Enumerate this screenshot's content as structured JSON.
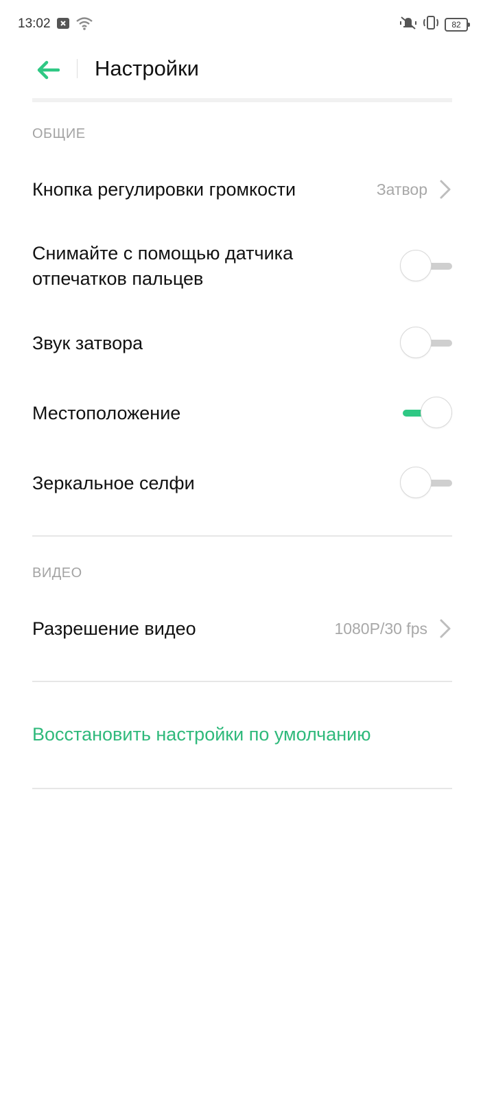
{
  "status_bar": {
    "time": "13:02",
    "battery_level": "82",
    "icons": [
      "notification-icon",
      "wifi-icon",
      "vibrate-icon",
      "rotate-icon",
      "battery-icon"
    ]
  },
  "app_bar": {
    "title": "Настройки"
  },
  "sections": {
    "general": {
      "header": "ОБЩИЕ",
      "volume_button": {
        "label": "Кнопка регулировки громкости",
        "value": "Затвор"
      },
      "fingerprint_shoot": {
        "label": "Снимайте с помощью датчика отпечатков пальцев",
        "enabled": false
      },
      "shutter_sound": {
        "label": "Звук затвора",
        "enabled": false
      },
      "location": {
        "label": "Местоположение",
        "enabled": true
      },
      "mirror_selfie": {
        "label": "Зеркальное селфи",
        "enabled": false
      }
    },
    "video": {
      "header": "ВИДЕО",
      "resolution": {
        "label": "Разрешение видео",
        "value": "1080P/30 fps"
      }
    }
  },
  "reset": {
    "label": "Восстановить настройки по умолчанию"
  },
  "colors": {
    "accent": "#2fc884",
    "link": "#2fb97b",
    "muted_text": "#a8a8a8"
  }
}
